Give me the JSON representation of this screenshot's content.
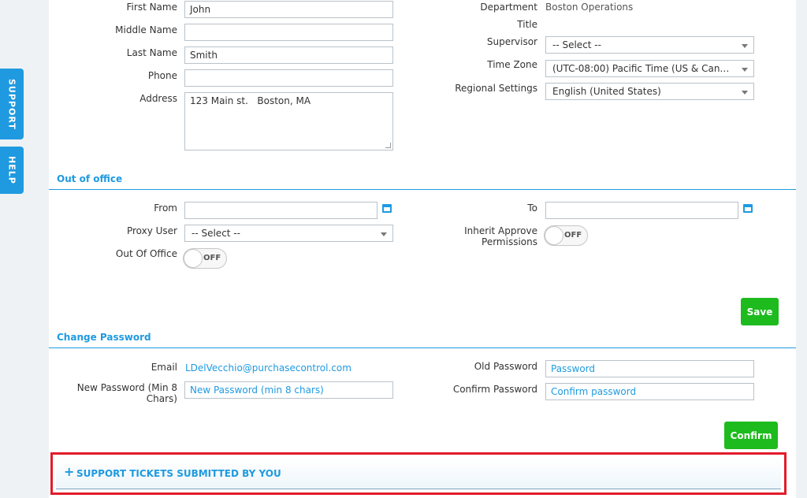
{
  "side_tabs": {
    "support": "SUPPORT",
    "help": "HELP"
  },
  "profile": {
    "first_name_label": "First Name",
    "first_name_value": "John",
    "middle_name_label": "Middle Name",
    "middle_name_value": "",
    "last_name_label": "Last Name",
    "last_name_value": "Smith",
    "phone_label": "Phone",
    "phone_value": "",
    "address_label": "Address",
    "address_value": "123 Main st.   Boston, MA",
    "department_label": "Department",
    "department_value": "Boston Operations",
    "title_label": "Title",
    "supervisor_label": "Supervisor",
    "supervisor_value": "-- Select --",
    "timezone_label": "Time Zone",
    "timezone_value": "(UTC-08:00) Pacific Time (US & Can…",
    "regional_label": "Regional Settings",
    "regional_value": "English (United States)"
  },
  "out_of_office": {
    "title": "Out of office",
    "from_label": "From",
    "to_label": "To",
    "proxy_label": "Proxy User",
    "proxy_value": "-- Select --",
    "inherit_label_1": "Inherit Approve",
    "inherit_label_2": "Permissions",
    "inherit_toggle": "OFF",
    "ooo_label": "Out Of Office",
    "ooo_toggle": "OFF",
    "save_label": "Save"
  },
  "change_password": {
    "title": "Change Password",
    "email_label": "Email",
    "email_value": "LDelVecchio@purchasecontrol.com",
    "new_password_label_1": "New Password (Min 8",
    "new_password_label_2": "Chars)",
    "new_password_placeholder": "New Password (min 8 chars)",
    "old_password_label": "Old Password",
    "old_password_placeholder": "Password",
    "confirm_password_label": "Confirm Password",
    "confirm_password_placeholder": "Confirm password",
    "confirm_label": "Confirm"
  },
  "tickets": {
    "title": "SUPPORT TICKETS SUBMITTED BY YOU"
  },
  "colors": {
    "accent": "#1f9ae0",
    "button": "#1dbb1d",
    "highlight": "#e21b2a"
  },
  "icons": {
    "calendar": "calendar-icon",
    "plus": "plus-icon",
    "caret": "chevron-down-icon"
  }
}
